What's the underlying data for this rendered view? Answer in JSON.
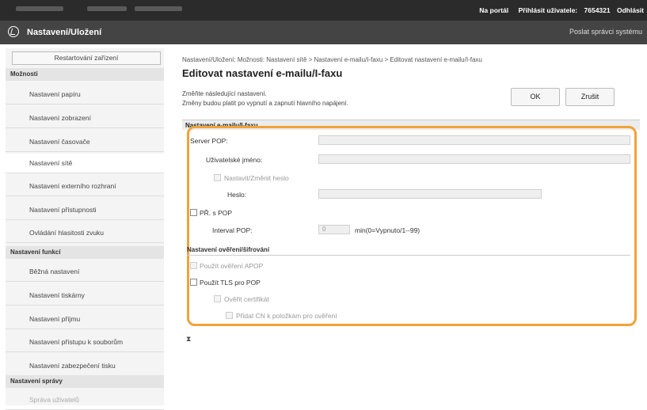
{
  "topbar": {
    "portal": "Na portál",
    "login_label": "Přihlásit uživatele:",
    "user_id": "7654321",
    "logout": "Odhlásit"
  },
  "header": {
    "title": "Nastavení/Uložení",
    "mail_link": "Poslat správci systému"
  },
  "sidebar": {
    "restart": "Restartování zařízení",
    "sections": [
      {
        "title": "Možnosti",
        "items": [
          {
            "label": "Nastavení papíru"
          },
          {
            "label": "Nastavení zobrazení"
          },
          {
            "label": "Nastavení časovače"
          },
          {
            "label": "Nastavení sítě"
          },
          {
            "label": "Nastavení externího rozhraní"
          },
          {
            "label": "Nastavení přístupnosti"
          },
          {
            "label": "Ovládání hlasitosti zvuku"
          }
        ]
      },
      {
        "title": "Nastavení funkcí",
        "items": [
          {
            "label": "Běžná nastavení"
          },
          {
            "label": "Nastavení tiskárny"
          },
          {
            "label": "Nastavení příjmu"
          },
          {
            "label": "Nastavení přístupu k souborům"
          },
          {
            "label": "Nastavení zabezpečení tisku"
          }
        ]
      },
      {
        "title": "Nastavení správy",
        "items": [
          {
            "label": "Správa uživatelů"
          }
        ]
      }
    ]
  },
  "main": {
    "breadcrumb": "Nastavení/Uložení: Možnosti: Nastavení sítě > Nastavení e-mailu/I-faxu > Editovat nastavení e-mailu/I-faxu",
    "title": "Editovat nastavení e-mailu/I-faxu",
    "desc_line1": "Změňte následující nastavení.",
    "desc_line2": "Změny budou platit po vypnutí a zapnutí hlavního napájení.",
    "ok": "OK",
    "cancel": "Zrušit",
    "section_title": "Nastavení e-mailu/I-faxu",
    "pop_server": "Server POP:",
    "username": "Uživatelské jméno:",
    "set_password": "Nastavit/Změnit heslo",
    "password": "Heslo:",
    "rx_pop": "PŘ. s POP",
    "pop_interval": "Interval POP:",
    "pop_interval_value": "0",
    "pop_interval_unit": "min(0=Vypnuto/1--99)",
    "auth_section": "Nastavení ověření/šifrování",
    "apop": "Použít ověření APOP",
    "tls": "Použít TLS pro POP",
    "verify_cert": "Ověřit certifikát",
    "add_cn": "Přidat CN k položkám pro ověření",
    "to_top": "⧗"
  },
  "colors": {
    "highlight": "#f0a23a"
  }
}
